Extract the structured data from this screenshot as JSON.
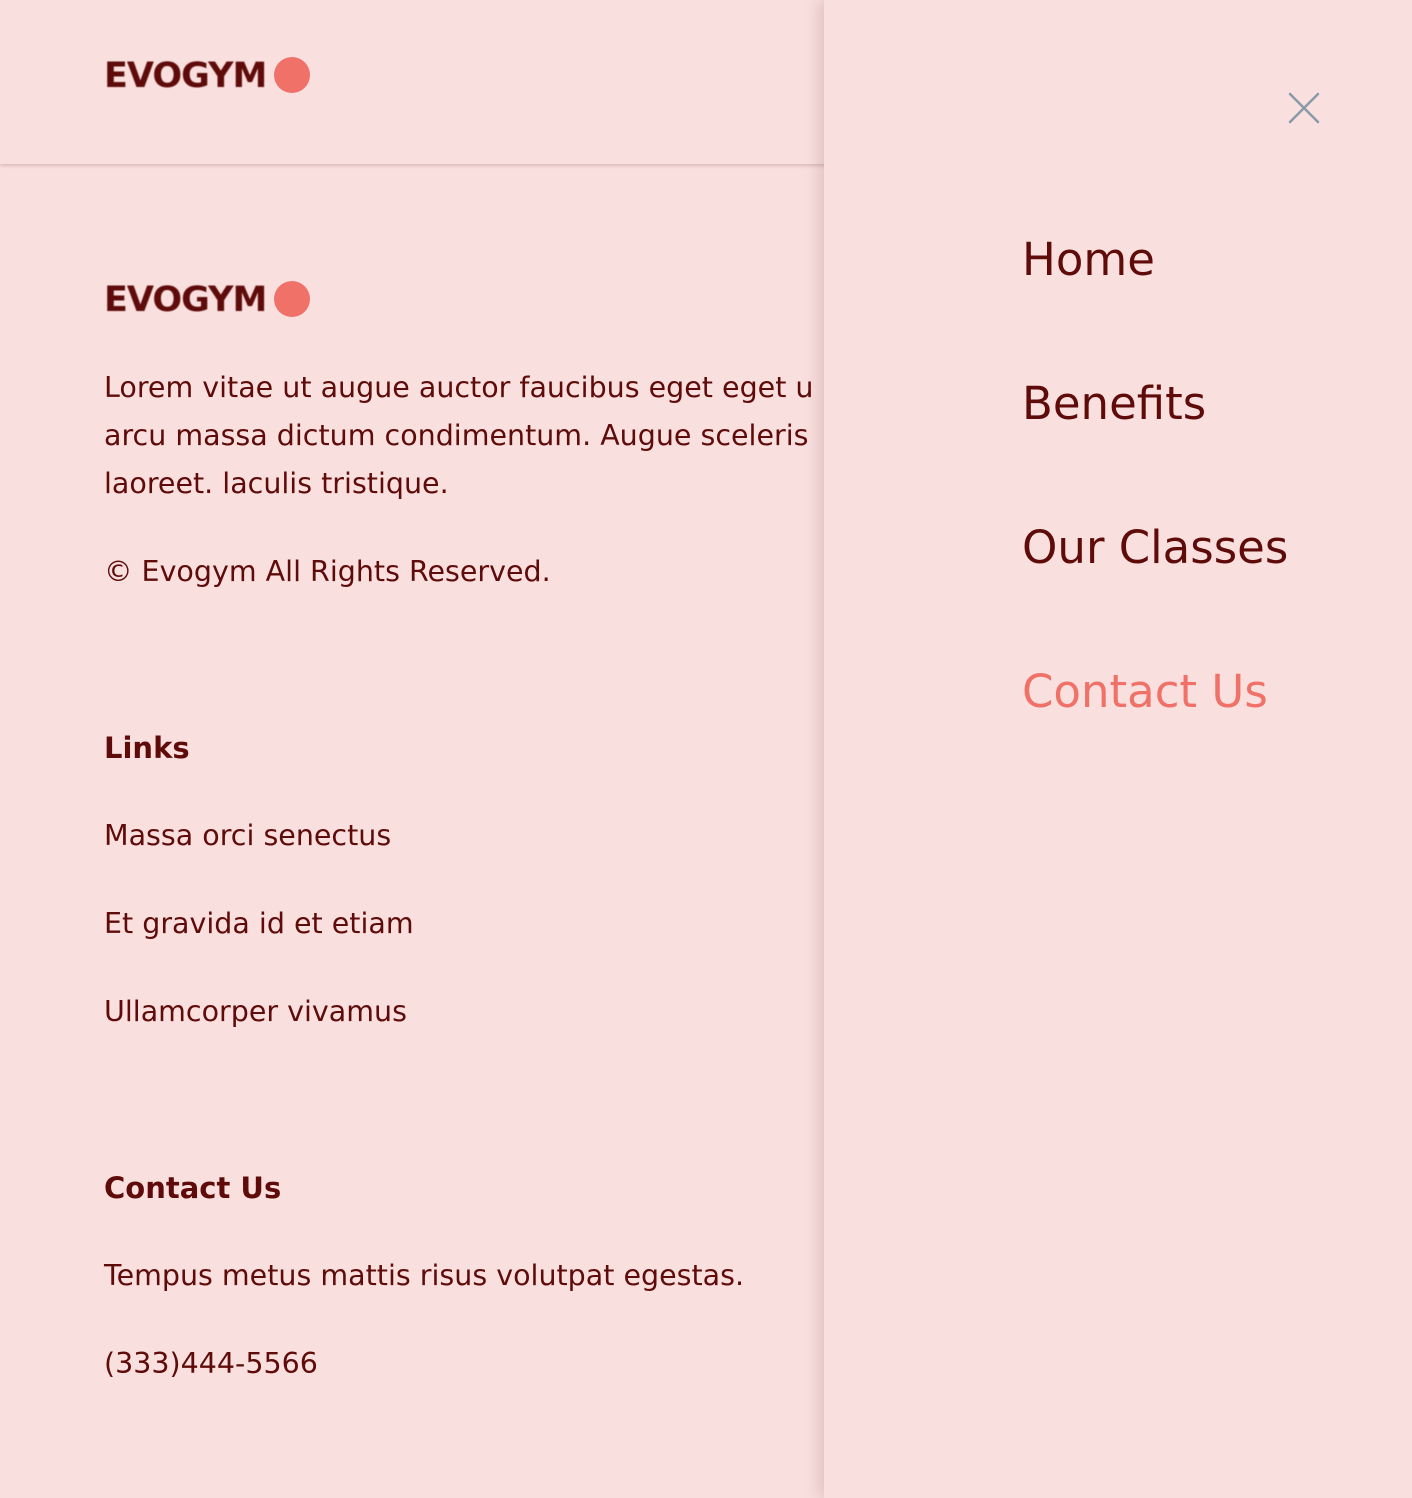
{
  "brand": {
    "name": "EVOGYM",
    "accent_color": "#f07167",
    "text_color": "#5e0b0a",
    "background_color": "#f9e0df"
  },
  "footer": {
    "description_lines": [
      "Lorem vitae ut augue auctor faucibus eget eget u",
      "arcu massa dictum condimentum. Augue sceleris",
      "laoreet. laculis tristique."
    ],
    "copyright": "© Evogym All Rights Reserved.",
    "links": {
      "heading": "Links",
      "items": [
        {
          "label": "Massa orci senectus"
        },
        {
          "label": "Et gravida id et etiam"
        },
        {
          "label": "Ullamcorper vivamus"
        }
      ]
    },
    "contact": {
      "heading": "Contact Us",
      "text": "Tempus metus mattis risus volutpat egestas.",
      "phone": "(333)444-5566"
    }
  },
  "menu": {
    "close_icon": "close-icon",
    "items": [
      {
        "label": "Home",
        "active": false
      },
      {
        "label": "Benefits",
        "active": false
      },
      {
        "label": "Our Classes",
        "active": false
      },
      {
        "label": "Contact Us",
        "active": true
      }
    ]
  }
}
